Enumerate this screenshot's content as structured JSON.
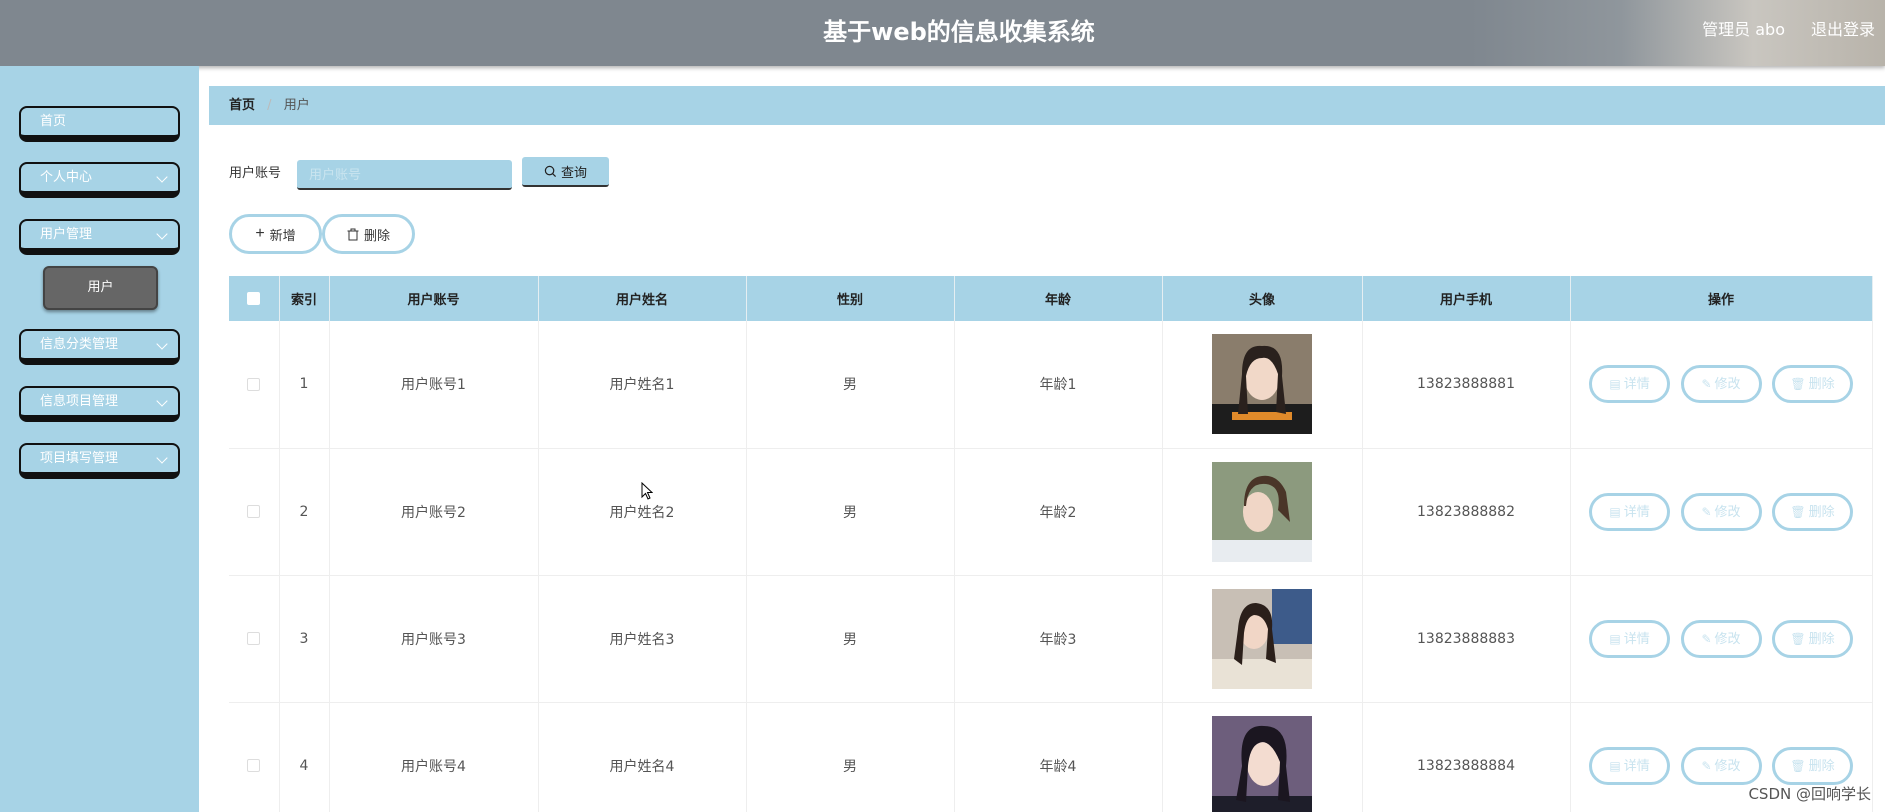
{
  "header": {
    "title": "基于web的信息收集系统",
    "user": "管理员 abo",
    "logout": "退出登录"
  },
  "sidebar": {
    "items": [
      {
        "label": "首页"
      },
      {
        "label": "个人中心"
      },
      {
        "label": "用户管理"
      },
      {
        "label": "信息分类管理"
      },
      {
        "label": "信息项目管理"
      },
      {
        "label": "项目填写管理"
      }
    ],
    "sub_item": "用户"
  },
  "breadcrumb": {
    "home": "首页",
    "separator": "/",
    "current": "用户"
  },
  "search": {
    "label": "用户账号",
    "placeholder": "用户账号",
    "button": "查询"
  },
  "actions": {
    "add": "新增",
    "delete": "删除"
  },
  "table": {
    "headers": [
      "索引",
      "用户账号",
      "用户姓名",
      "性别",
      "年龄",
      "头像",
      "用户手机",
      "操作"
    ],
    "rows": [
      {
        "index": "1",
        "account": "用户账号1",
        "name": "用户姓名1",
        "gender": "男",
        "age": "年龄1",
        "phone": "13823888881"
      },
      {
        "index": "2",
        "account": "用户账号2",
        "name": "用户姓名2",
        "gender": "男",
        "age": "年龄2",
        "phone": "13823888882"
      },
      {
        "index": "3",
        "account": "用户账号3",
        "name": "用户姓名3",
        "gender": "男",
        "age": "年龄3",
        "phone": "13823888883"
      },
      {
        "index": "4",
        "account": "用户账号4",
        "name": "用户姓名4",
        "gender": "男",
        "age": "年龄4",
        "phone": "13823888884"
      }
    ],
    "row_actions": {
      "detail": "详情",
      "edit": "修改",
      "delete": "删除"
    }
  },
  "watermark": "CSDN @回响学长",
  "colors": {
    "accent": "#a7d3e6",
    "header": "#7f878f",
    "submenu_active": "#666666"
  }
}
